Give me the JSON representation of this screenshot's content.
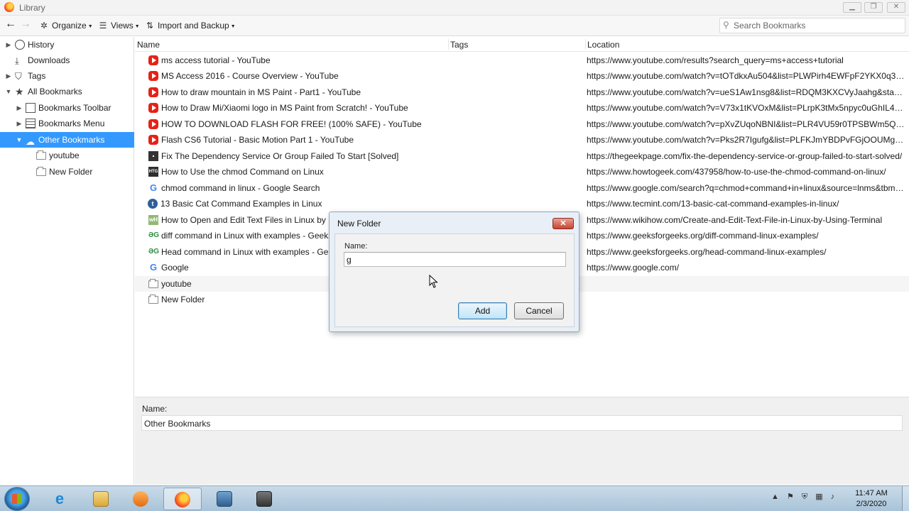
{
  "window": {
    "title": "Library",
    "controls": [
      "minimize",
      "maximize",
      "close"
    ]
  },
  "toolbar": {
    "back_icon": "back-arrow-icon",
    "forward_icon": "forward-arrow-icon",
    "organize": "Organize",
    "views": "Views",
    "import_backup": "Import and Backup",
    "search_placeholder": "Search Bookmarks"
  },
  "sidebar": {
    "items": [
      {
        "label": "History",
        "icon": "clock-icon",
        "twisty": "collapsed",
        "indent": 0
      },
      {
        "label": "Downloads",
        "icon": "download-icon",
        "twisty": "none",
        "indent": 0
      },
      {
        "label": "Tags",
        "icon": "tag-icon",
        "twisty": "collapsed",
        "indent": 0
      },
      {
        "label": "All Bookmarks",
        "icon": "star-icon",
        "twisty": "expanded",
        "indent": 0
      },
      {
        "label": "Bookmarks Toolbar",
        "icon": "toolbar-folder-icon",
        "twisty": "collapsed",
        "indent": 1
      },
      {
        "label": "Bookmarks Menu",
        "icon": "menu-folder-icon",
        "twisty": "collapsed",
        "indent": 1
      },
      {
        "label": "Other Bookmarks",
        "icon": "cloud-folder-icon",
        "twisty": "expanded",
        "indent": 1,
        "selected": true
      },
      {
        "label": "youtube",
        "icon": "folder-icon",
        "twisty": "none",
        "indent": 2
      },
      {
        "label": "New Folder",
        "icon": "folder-icon",
        "twisty": "none",
        "indent": 2
      }
    ]
  },
  "columns": {
    "name": "Name",
    "tags": "Tags",
    "location": "Location"
  },
  "bookmarks": [
    {
      "name": "ms access tutorial - YouTube",
      "location": "https://www.youtube.com/results?search_query=ms+access+tutorial",
      "icon": "youtube-icon"
    },
    {
      "name": "MS Access 2016 - Course Overview - YouTube",
      "location": "https://www.youtube.com/watch?v=tOTdkxAu504&list=PLWPirh4EWFpF2YKX0q305LqZ...",
      "icon": "youtube-icon"
    },
    {
      "name": "How to draw mountain in MS Paint - Part1 - YouTube",
      "location": "https://www.youtube.com/watch?v=ueS1Aw1nsg8&list=RDQM3KXCVyJaahg&start_radi...",
      "icon": "youtube-icon"
    },
    {
      "name": "How to Draw Mi/Xiaomi logo in MS Paint from Scratch! - YouTube",
      "location": "https://www.youtube.com/watch?v=V73x1tKVOxM&list=PLrpK3tMx5npyc0uGhIL4vQpe...",
      "icon": "youtube-icon"
    },
    {
      "name": "HOW TO DOWNLOAD FLASH FOR FREE! (100% SAFE) - YouTube",
      "location": "https://www.youtube.com/watch?v=pXvZUqoNBNI&list=PLR4VU59r0TPSBWm5Q-Dw-9...",
      "icon": "youtube-icon"
    },
    {
      "name": "Flash CS6 Tutorial - Basic Motion Part 1 - YouTube",
      "location": "https://www.youtube.com/watch?v=Pks2R7Igufg&list=PLFKJmYBDPvFGjOOUMgx6DDfC...",
      "icon": "youtube-icon"
    },
    {
      "name": "Fix The Dependency Service Or Group Failed To Start [Solved]",
      "location": "https://thegeekpage.com/fix-the-dependency-service-or-group-failed-to-start-solved/",
      "icon": "windows-icon"
    },
    {
      "name": "How to Use the chmod Command on Linux",
      "location": "https://www.howtogeek.com/437958/how-to-use-the-chmod-command-on-linux/",
      "icon": "htg-icon"
    },
    {
      "name": "chmod command in linux - Google Search",
      "location": "https://www.google.com/search?q=chmod+command+in+linux&source=lnms&tbm=v...",
      "icon": "google-icon"
    },
    {
      "name": "13 Basic Cat Command Examples in Linux",
      "location": "https://www.tecmint.com/13-basic-cat-command-examples-in-linux/",
      "icon": "tecmint-icon"
    },
    {
      "name": "How to Open and Edit Text Files in Linux by Usin",
      "location": "https://www.wikihow.com/Create-and-Edit-Text-File-in-Linux-by-Using-Terminal",
      "icon": "wikihow-icon"
    },
    {
      "name": "diff command in Linux with examples - Geeksfo",
      "location": "https://www.geeksforgeeks.org/diff-command-linux-examples/",
      "icon": "gfg-icon"
    },
    {
      "name": "Head command in Linux with examples - Geeksf",
      "location": "https://www.geeksforgeeks.org/head-command-linux-examples/",
      "icon": "gfg-icon"
    },
    {
      "name": "Google",
      "location": "https://www.google.com/",
      "icon": "google-icon"
    },
    {
      "name": "youtube",
      "location": "",
      "icon": "folder-icon"
    },
    {
      "name": "New Folder",
      "location": "",
      "icon": "folder-icon"
    }
  ],
  "details": {
    "name_label": "Name:",
    "name_value": "Other Bookmarks"
  },
  "dialog": {
    "title": "New Folder",
    "close_label": "✕",
    "name_label": "Name:",
    "name_value": "g",
    "add_label": "Add",
    "cancel_label": "Cancel"
  },
  "taskbar": {
    "apps": [
      "internet-explorer-icon",
      "file-explorer-icon",
      "media-player-icon",
      "firefox-icon",
      "network-app-icon",
      "video-recorder-icon"
    ],
    "active": "firefox-icon",
    "time": "11:47 AM",
    "date": "2/3/2020"
  }
}
